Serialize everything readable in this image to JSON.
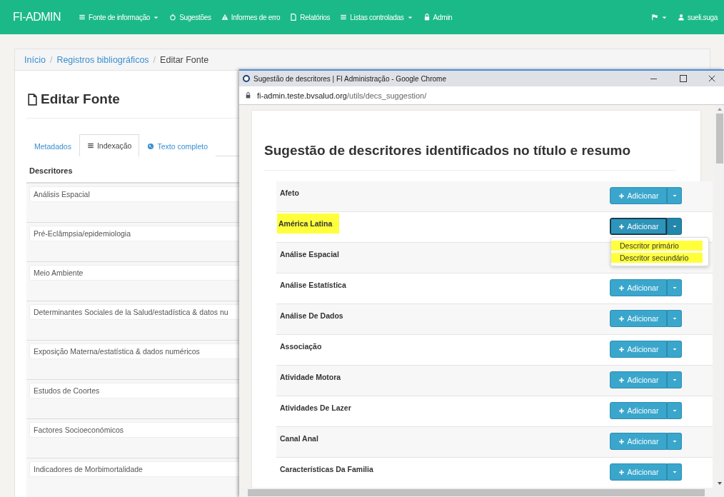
{
  "navbar": {
    "brand": "FI-ADMIN",
    "items": [
      {
        "label": "Fonte de informação",
        "dropdown": true
      },
      {
        "label": "Sugestões",
        "dropdown": false
      },
      {
        "label": "Informes de erro",
        "dropdown": false
      },
      {
        "label": "Relatórios",
        "dropdown": false
      },
      {
        "label": "Listas controladas",
        "dropdown": true
      },
      {
        "label": "Admin",
        "dropdown": false
      }
    ],
    "right": [
      {
        "dropdown": true
      },
      {
        "label": "sueli.suga",
        "dropdown": false
      }
    ]
  },
  "breadcrumb": [
    {
      "kind": "link",
      "label": "Início"
    },
    {
      "kind": "separator",
      "label": "/"
    },
    {
      "kind": "link",
      "label": "Registros bibliográficos"
    },
    {
      "kind": "separator",
      "label": "/"
    },
    {
      "kind": "current",
      "label": "Editar Fonte"
    }
  ],
  "page_title": "Editar Fonte",
  "tabs": [
    {
      "label": "Metadados",
      "selected": false
    },
    {
      "label": "Indexação",
      "selected": true
    },
    {
      "label": "Texto completo",
      "selected": false
    }
  ],
  "descriptors": {
    "heading": "Descritores",
    "fields": [
      "Análisis Espacial",
      "Pré-Eclâmpsia/epidemiologia",
      "Meio Ambiente",
      "Determinantes Sociales de la Salud/estadística & datos nu",
      "Exposição Materna/estatística & dados numéricos",
      "Estudos de Coortes",
      "Factores Socioeconómicos",
      "Indicadores de Morbimortalidade"
    ]
  },
  "popup": {
    "window_title": "Sugestão de descritores | FI Administração - Google Chrome",
    "url_host": "fi-admin.teste.bvsalud.org",
    "url_path": "/utils/decs_suggestion/",
    "heading": "Sugestão de descritores identificados no título e resumo",
    "rows": [
      {
        "term": "Afeto",
        "button": "Adicionar",
        "highlighted": false,
        "focused": false,
        "menu_open": false
      },
      {
        "term": "América Latina",
        "button": "Adicionar",
        "highlighted": true,
        "focused": true,
        "menu_open": true
      },
      {
        "term": "Análise Espacial",
        "highlighted": false
      },
      {
        "term": "Análise Estatística",
        "button": "Adicionar",
        "highlighted": false,
        "focused": false,
        "menu_open": false
      },
      {
        "term": "Análise De Dados",
        "button": "Adicionar",
        "highlighted": false,
        "focused": false,
        "menu_open": false
      },
      {
        "term": "Associação",
        "button": "Adicionar",
        "highlighted": false,
        "focused": false,
        "menu_open": false
      },
      {
        "term": "Atividade Motora",
        "button": "Adicionar",
        "highlighted": false,
        "focused": false,
        "menu_open": false
      },
      {
        "term": "Atividades De Lazer",
        "button": "Adicionar",
        "highlighted": false,
        "focused": false,
        "menu_open": false
      },
      {
        "term": "Canal Anal",
        "button": "Adicionar",
        "highlighted": false,
        "focused": false,
        "menu_open": false
      },
      {
        "term": "Características Da Familia",
        "button": "Adicionar",
        "highlighted": false,
        "focused": false,
        "menu_open": false
      }
    ],
    "menu": [
      {
        "label": "Descritor primário",
        "highlighted": true
      },
      {
        "label": "Descritor secundário",
        "highlighted": true
      }
    ]
  }
}
